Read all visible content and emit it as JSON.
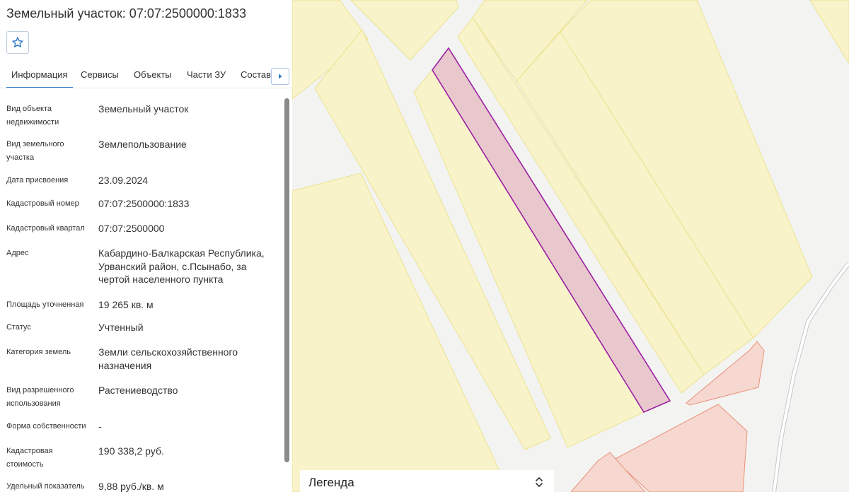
{
  "panel": {
    "title": "Земельный участок: 07:07:2500000:1833",
    "favorite_icon": "star-icon",
    "tabs": [
      {
        "label": "Информация",
        "active": true
      },
      {
        "label": "Сервисы",
        "active": false
      },
      {
        "label": "Объекты",
        "active": false
      },
      {
        "label": "Части ЗУ",
        "active": false
      },
      {
        "label": "Состав",
        "active": false
      }
    ],
    "tabs_next_icon": "caret-right-icon",
    "rows": [
      {
        "label": "Вид объекта недвижимости",
        "value": "Земельный участок"
      },
      {
        "label": "Вид земельного участка",
        "value": "Землепользование"
      },
      {
        "label": "Дата присвоения",
        "value": "23.09.2024"
      },
      {
        "label": "Кадастровый номер",
        "value": "07:07:2500000:1833"
      },
      {
        "label": "Кадастровый квартал",
        "value": "07:07:2500000"
      },
      {
        "label": "Адрес",
        "value": "Кабардино-Балкарская Республика, Урванский район, с.Псынабо, за чертой населенного пункта"
      },
      {
        "label": "Площадь уточненная",
        "value": "19 265 кв. м"
      },
      {
        "label": "Статус",
        "value": "Учтенный"
      },
      {
        "label": "Категория земель",
        "value": "Земли сельскохозяйственного назначения"
      },
      {
        "label": "Вид разрешенного использования",
        "value": "Растениеводство"
      },
      {
        "label": "Форма собственности",
        "value": "-"
      },
      {
        "label": "Кадастровая стоимость",
        "value": "190 338,2 руб."
      },
      {
        "label": "Удельный показатель",
        "value": "9,88 руб./кв. м"
      }
    ]
  },
  "legend": {
    "label": "Легенда",
    "toggle_icon": "chevron-up-down-icon"
  },
  "colors": {
    "parcel_fill": "#f8f3c9",
    "parcel_stroke": "#ece38f",
    "selected_fill": "#e9c8cd",
    "selected_stroke": "#9b1fa3",
    "zone_fill": "#f6d8d0",
    "zone_stroke": "#e9927a",
    "tab_active": "#2b78c6"
  }
}
